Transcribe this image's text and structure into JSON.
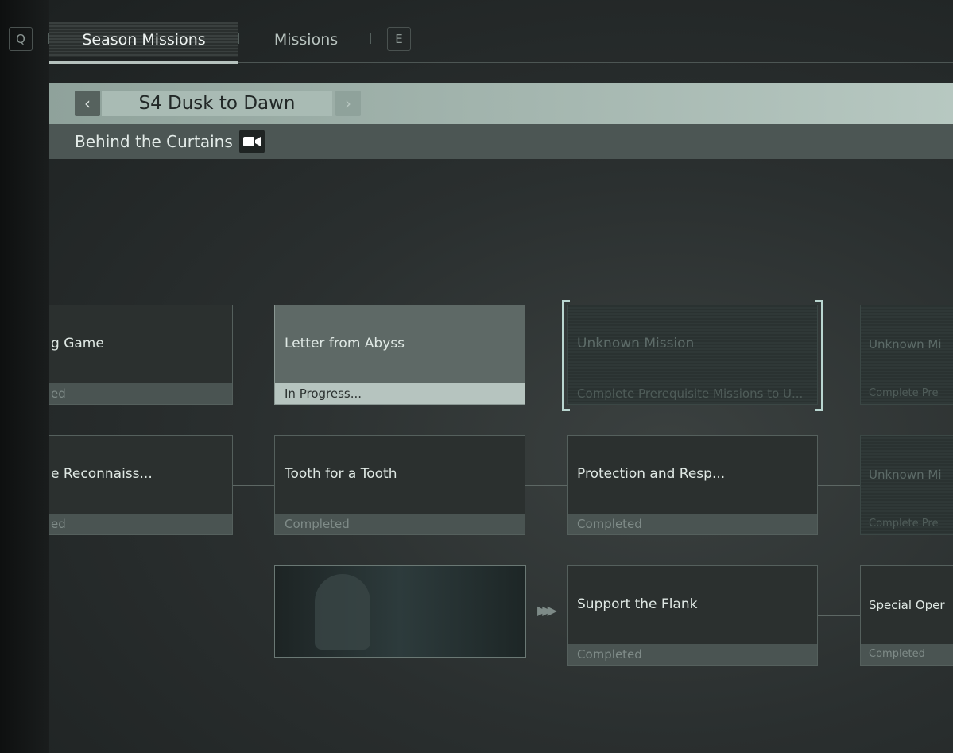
{
  "tabs": {
    "prev_key": "Q",
    "next_key": "E",
    "items": [
      {
        "label": "Season Missions",
        "active": true
      },
      {
        "label": "Missions",
        "active": false
      }
    ]
  },
  "season": {
    "name": "S4 Dusk to Dawn",
    "prev_icon": "chevron-left-icon",
    "next_icon": "chevron-right-icon"
  },
  "chapter": {
    "title": "Behind the Curtains",
    "icon": "video-camera-icon"
  },
  "cards": [
    {
      "title": "g Game",
      "status": "ed",
      "state": "completed"
    },
    {
      "title": "Letter from Abyss",
      "status": "In Progress...",
      "state": "in-progress"
    },
    {
      "title": "Unknown Mission",
      "status": "Complete Prerequisite Missions to U...",
      "state": "locked"
    },
    {
      "title": "Unknown Mi",
      "status": "Complete Pre",
      "state": "locked"
    },
    {
      "title": "e Reconnaiss...",
      "status": "ed",
      "state": "completed"
    },
    {
      "title": "Tooth for a Tooth",
      "status": "Completed",
      "state": "completed"
    },
    {
      "title": "Protection and Resp...",
      "status": "Completed",
      "state": "completed"
    },
    {
      "title": "Unknown Mi",
      "status": "Complete Pre",
      "state": "locked"
    },
    {
      "title": "Support the Flank",
      "status": "Completed",
      "state": "completed"
    },
    {
      "title": "Special Oper",
      "status": "Completed",
      "state": "completed"
    }
  ],
  "arrow": "▶▶▶"
}
